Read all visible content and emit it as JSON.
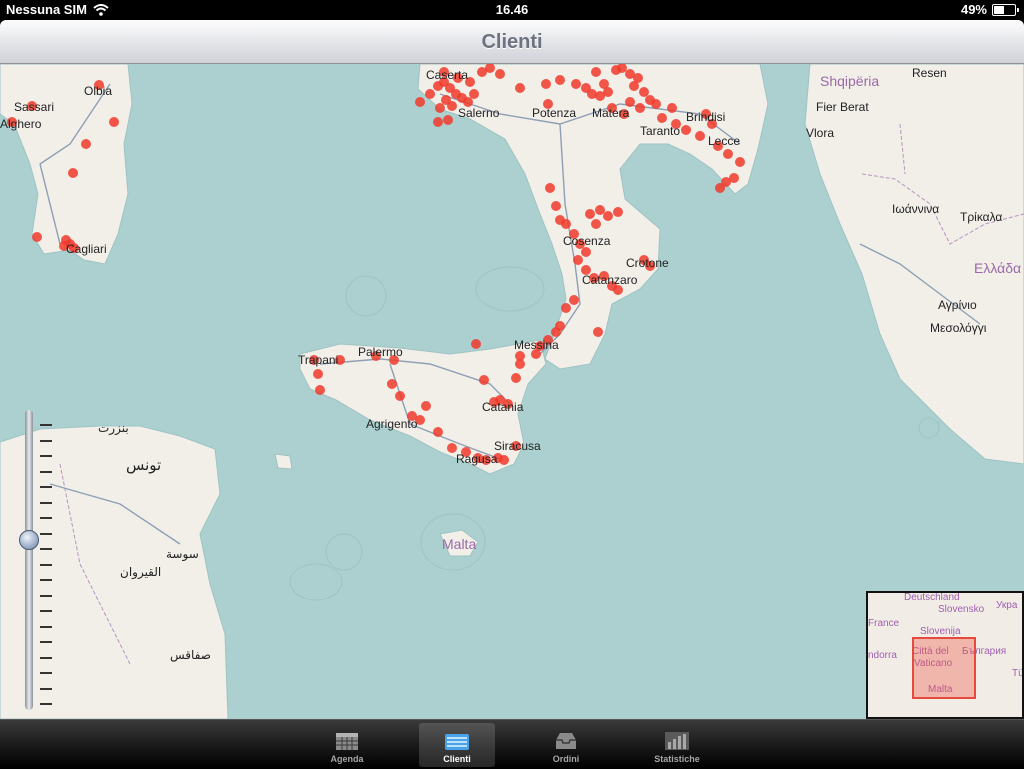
{
  "status_bar": {
    "carrier": "Nessuna SIM",
    "time": "16.46",
    "battery_percent": "49%",
    "battery_level": 0.49
  },
  "nav": {
    "title": "Clienti"
  },
  "map": {
    "labels": {
      "sassari": "Sassari",
      "olbia": "Olbia",
      "alghero": "Alghero",
      "cagliari": "Cagliari",
      "caserta": "Caserta",
      "salerno": "Salerno",
      "potenza": "Potenza",
      "matera": "Matera",
      "brindisi": "Brindisi",
      "taranto": "Taranto",
      "lecce": "Lecce",
      "cosenza": "Cosenza",
      "crotone": "Crotone",
      "catanzaro": "Catanzaro",
      "messina": "Messina",
      "palermo": "Palermo",
      "trapani": "Trapani",
      "catania": "Catania",
      "agrigento": "Agrigento",
      "siracusa": "Siracusa",
      "ragusa": "Ragusa",
      "malta": "Malta",
      "shqiperia": "Shqipëria",
      "fier_berat": "Fier Berat",
      "vlora": "Vlora",
      "resen": "Resen",
      "ioannina": "Ιωάννινα",
      "trikala": "Τρίκαλα",
      "ellada": "Ελλάδα",
      "agrinio": "Αγρίνιο",
      "mesolongi": "Μεσολόγγι",
      "bizerte": "بنزرت",
      "tunis": "تونس",
      "sousse": "سوسة",
      "kairouan": "القيروان",
      "sfax": "صفاقس"
    },
    "zoom_level_fraction": 0.4
  },
  "overview": {
    "labels": {
      "deutschland": "Deutschland",
      "slovensko": "Slovensko",
      "ukraine": "Укра",
      "france": "France",
      "slovenija": "Slovenija",
      "andorra": "ndorra",
      "citta": "Città del",
      "vaticano": "Vaticano",
      "bulgaria": "България",
      "malta": "Malta",
      "tu": "Tü"
    }
  },
  "tabs": [
    {
      "label": "Agenda",
      "icon": "calendar-icon"
    },
    {
      "label": "Clienti",
      "icon": "clients-icon"
    },
    {
      "label": "Ordini",
      "icon": "inbox-icon"
    },
    {
      "label": "Statistiche",
      "icon": "bar-chart-icon"
    }
  ],
  "active_tab": "Clienti",
  "colors": {
    "marker": "#f03a2c",
    "sea": "#acd0d0",
    "land": "#f2efe9",
    "border": "#b695c0",
    "road": "#8e9fb5"
  }
}
